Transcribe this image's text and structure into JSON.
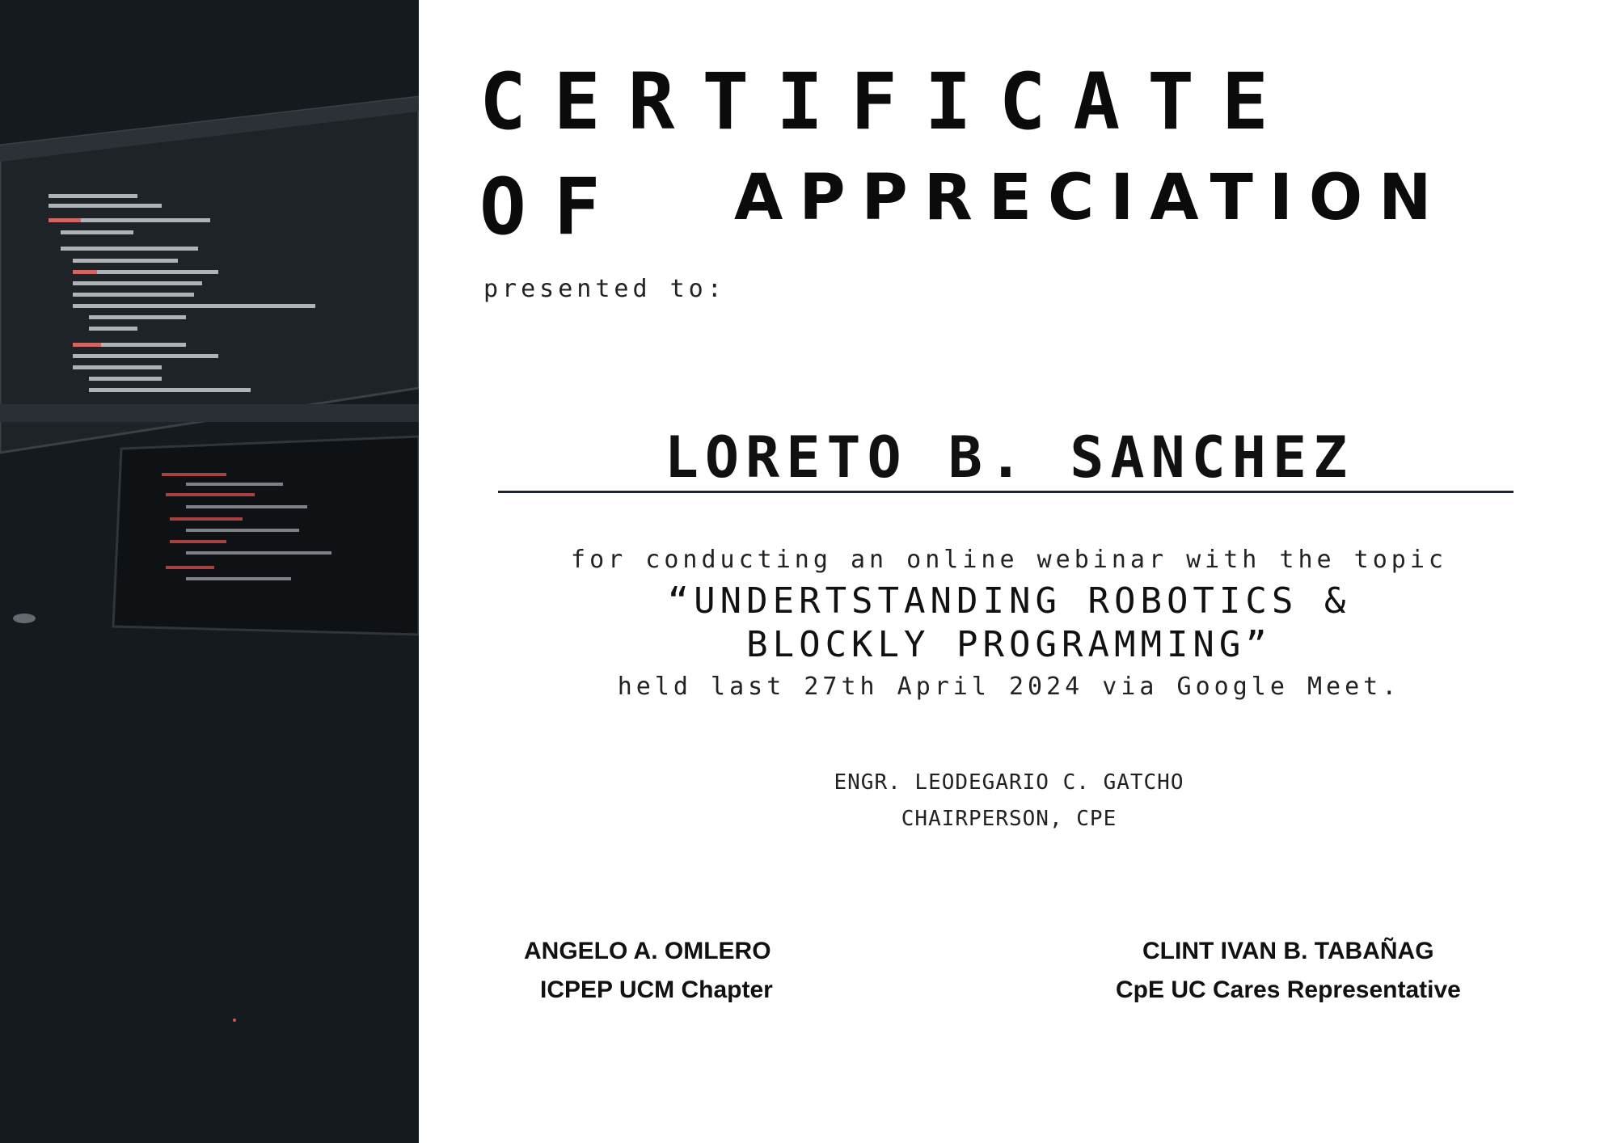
{
  "certificate": {
    "title_line1": "CERTIFICATE",
    "title_line2_prefix": "OF",
    "title_line2": "APPRECIATION",
    "presented_label": "presented to:",
    "recipient": "LORETO B. SANCHEZ",
    "description": "for conducting an online webinar with the topic",
    "topic_line1": "“UNDERTSTANDING ROBOTICS &",
    "topic_line2": "BLOCKLY PROGRAMMING”",
    "held": "held last 27th April 2024 via Google Meet.",
    "chairperson": {
      "name": "ENGR. LEODEGARIO C. GATCHO",
      "role": "CHAIRPERSON, CPE"
    },
    "signatories": [
      {
        "name": "ANGELO A. OMLERO",
        "role": "ICPEP UCM Chapter"
      },
      {
        "name": "CLINT IVAN B. TABAÑAG",
        "role": "CpE UC Cares Representative"
      }
    ]
  },
  "colors": {
    "side_panel": "#151a1e",
    "code_text": "#c9cdd2",
    "code_accent": "#d9534f",
    "rule": "#1c2430"
  }
}
